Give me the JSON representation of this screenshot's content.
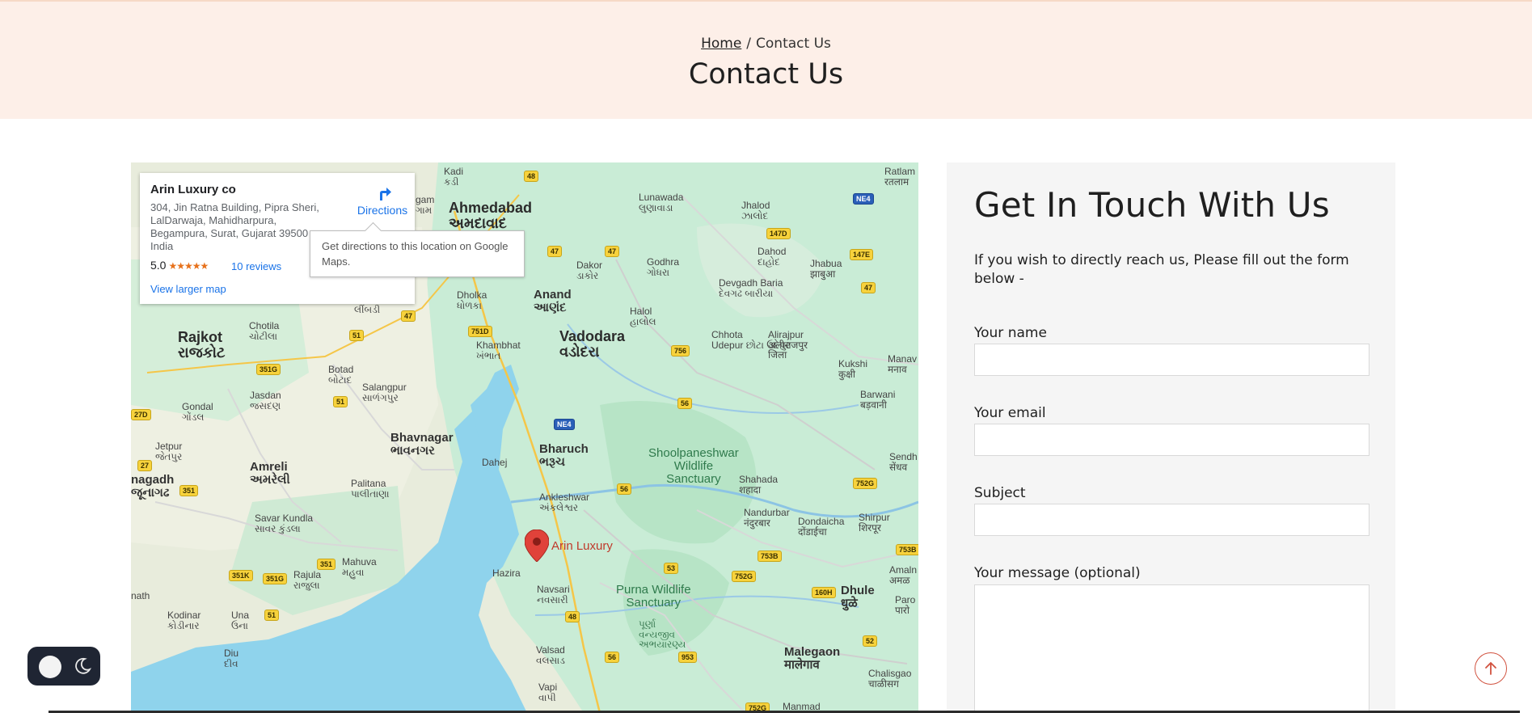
{
  "breadcrumb": {
    "home": "Home",
    "separator": "/",
    "current": "Contact Us"
  },
  "page_title": "Contact Us",
  "map": {
    "info_card": {
      "name": "Arin Luxury co",
      "address": "304, Jin Ratna Building, Pipra Sheri, LalDarwaja, Mahidharpura, Begampura, Surat, Gujarat 39500 India",
      "rating": "5.0",
      "stars": "★★★★★",
      "reviews": "10 reviews",
      "view_larger": "View larger map",
      "directions": "Directions"
    },
    "tooltip": "Get directions to this location on Google Maps.",
    "pin_label": "Arin Luxury",
    "labels": {
      "ahmedabad": "Ahmedabad",
      "ahmedabad_gu": "અમદાવાદ",
      "vadodara": "Vadodara",
      "vadodara_gu": "વડોદરા",
      "rajkot": "Rajkot",
      "rajkot_gu": "રાજકોટ",
      "bhavnagar": "Bhavnagar",
      "bhavnagar_gu": "ભાવનગર",
      "anand": "Anand",
      "anand_gu": "આણંદ",
      "bharuch": "Bharuch",
      "bharuch_gu": "ભરૂચ",
      "amreli": "Amreli",
      "amreli_gu": "અમરેલી",
      "dhule": "Dhule",
      "dhule_gu": "धुळे",
      "malegaon": "Malegaon",
      "malegaon_gu": "मालेगाव",
      "lunawada": "Lunawada",
      "lunawada_gu": "લુણાવાડા",
      "jhalod": "Jhalod",
      "jhalod_gu": "ઝાલોદ",
      "dahod": "Dahod",
      "dahod_gu": "દાહોદ",
      "jhabua": "Jhabua",
      "jhabua_gu": "झाबुआ",
      "godhra": "Godhra",
      "godhra_gu": "ગોધરા",
      "dakor": "Dakor",
      "dakor_gu": "ડાકોર",
      "devgadh": "Devgadh Baria",
      "devgadh_gu": "દેવગઢ બારીયા",
      "halol": "Halol",
      "halol_gu": "હાલોલ",
      "chhota": "Chhota",
      "chhota2": "Udepur",
      "chhota_gu": "છોટા ઉદેપુર",
      "alirajpur": "Alirajpur",
      "alirajpur_hi": "अलीराजपुर",
      "alirajpur_hi2": "जिला",
      "dholka": "Dholka",
      "dholka_gu": "ધોળકા",
      "khambhat": "Khambhat",
      "khambhat_gu": "ખંભાત",
      "chotila": "Chotila",
      "chotila_gu": "ચોટીલા",
      "limbdi": "લીંબડી",
      "botad": "Botad",
      "botad_gu": "બોટાદ",
      "salangpur": "Salangpur",
      "salangpur_gu": "સાળંગપુર",
      "jasdan": "Jasdan",
      "jasdan_gu": "જસદણ",
      "gondal": "Gondal",
      "gondal_gu": "ગોંડલ",
      "jetpur": "Jetpur",
      "jetpur_gu": "જેતપુર",
      "junagadh": "nagadh",
      "junagadh_gu": "જૂનાગઢ",
      "palitana": "Palitana",
      "palitana_gu": "પાલીતાણા",
      "savar": "Savar Kundla",
      "savar_gu": "સાવર કુંડલા",
      "mahuva": "Mahuva",
      "mahuva_gu": "મહુવા",
      "rajula": "Rajula",
      "rajula_gu": "રાજુલા",
      "kodinar": "Kodinar",
      "kodinar_gu": "કોડીનાર",
      "una": "Una",
      "una_gu": "ઉના",
      "diu": "Diu",
      "diu_gu": "દીવ",
      "nath": "nath",
      "dahej": "Dahej",
      "ankleshwar": "Ankleshwar",
      "ankleshwar_gu": "અંકલેશ્વર",
      "hazira": "Hazira",
      "navsari": "Navsari",
      "navsari_gu": "નવસારી",
      "valsad": "Valsad",
      "valsad_gu": "વલસાડ",
      "vapi": "Vapi",
      "vapi_gu": "વાપી",
      "shoolpaneshwar": "Shoolpaneshwar",
      "shoolpaneshwar2": "Wildlife",
      "shoolpaneshwar3": "Sanctuary",
      "purna": "Purna Wildlife",
      "purna2": "Sanctuary",
      "purna_gu": "પૂર્ણા",
      "purna_gu2": "વન્યજીવ",
      "purna_gu3": "અભયારણ્ય",
      "shahada": "Shahada",
      "shahada_hi": "शहादा",
      "nandurbar": "Nandurbar",
      "nandurbar_hi": "नंदुरबार",
      "dondaicha": "Dondaicha",
      "dondaicha_hi": "दोंडाईचा",
      "shirpur": "Shirpur",
      "shirpur_hi": "शिरपूर",
      "kukshi": "Kukshi",
      "kukshi_hi": "कुक्षी",
      "barwani": "Barwani",
      "barwani_hi": "बड़वानी",
      "manav": "Manav",
      "manav_hi": "मनाव",
      "sendh": "Sendh",
      "sendh_hi": "सेंधव",
      "amaln": "Amaln",
      "amaln_hi": "अमळ",
      "paro": "Paro",
      "paro_hi": "पारो",
      "chalisgao": "Chalisgao",
      "chalisgao_hi": "चाळीसग",
      "manmad": "Manmad",
      "ratlam": "Ratlam",
      "ratlam_hi": "रतलाम",
      "kadi": "Kadi",
      "kadi_gu": "કડી",
      "gam": "gam",
      "gam_gu": "ગામ"
    },
    "shields": [
      "48",
      "47",
      "47",
      "147D",
      "NE4",
      "147E",
      "47",
      "751D",
      "756",
      "56",
      "51",
      "351G",
      "51",
      "27D",
      "27",
      "351",
      "NE4",
      "56",
      "752G",
      "753B",
      "753B",
      "53",
      "752G",
      "160H",
      "52",
      "48",
      "56",
      "953",
      "752G",
      "351",
      "351K",
      "351G",
      "51",
      "47"
    ]
  },
  "form": {
    "heading": "Get In Touch With Us",
    "intro": "If you wish to directly reach us, Please fill out the form below -",
    "name_label": "Your name",
    "email_label": "Your email",
    "subject_label": "Subject",
    "message_label": "Your message (optional)"
  }
}
